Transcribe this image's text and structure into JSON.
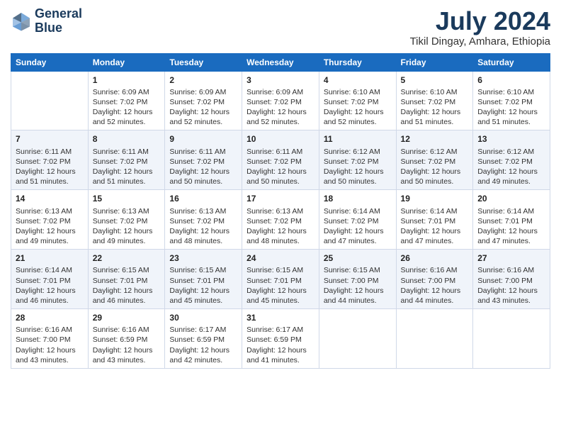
{
  "header": {
    "logo_line1": "General",
    "logo_line2": "Blue",
    "title": "July 2024",
    "subtitle": "Tikil Dingay, Amhara, Ethiopia"
  },
  "calendar": {
    "days_of_week": [
      "Sunday",
      "Monday",
      "Tuesday",
      "Wednesday",
      "Thursday",
      "Friday",
      "Saturday"
    ],
    "weeks": [
      [
        {
          "day": "",
          "info": ""
        },
        {
          "day": "1",
          "info": "Sunrise: 6:09 AM\nSunset: 7:02 PM\nDaylight: 12 hours\nand 52 minutes."
        },
        {
          "day": "2",
          "info": "Sunrise: 6:09 AM\nSunset: 7:02 PM\nDaylight: 12 hours\nand 52 minutes."
        },
        {
          "day": "3",
          "info": "Sunrise: 6:09 AM\nSunset: 7:02 PM\nDaylight: 12 hours\nand 52 minutes."
        },
        {
          "day": "4",
          "info": "Sunrise: 6:10 AM\nSunset: 7:02 PM\nDaylight: 12 hours\nand 52 minutes."
        },
        {
          "day": "5",
          "info": "Sunrise: 6:10 AM\nSunset: 7:02 PM\nDaylight: 12 hours\nand 51 minutes."
        },
        {
          "day": "6",
          "info": "Sunrise: 6:10 AM\nSunset: 7:02 PM\nDaylight: 12 hours\nand 51 minutes."
        }
      ],
      [
        {
          "day": "7",
          "info": "Sunrise: 6:11 AM\nSunset: 7:02 PM\nDaylight: 12 hours\nand 51 minutes."
        },
        {
          "day": "8",
          "info": "Sunrise: 6:11 AM\nSunset: 7:02 PM\nDaylight: 12 hours\nand 51 minutes."
        },
        {
          "day": "9",
          "info": "Sunrise: 6:11 AM\nSunset: 7:02 PM\nDaylight: 12 hours\nand 50 minutes."
        },
        {
          "day": "10",
          "info": "Sunrise: 6:11 AM\nSunset: 7:02 PM\nDaylight: 12 hours\nand 50 minutes."
        },
        {
          "day": "11",
          "info": "Sunrise: 6:12 AM\nSunset: 7:02 PM\nDaylight: 12 hours\nand 50 minutes."
        },
        {
          "day": "12",
          "info": "Sunrise: 6:12 AM\nSunset: 7:02 PM\nDaylight: 12 hours\nand 50 minutes."
        },
        {
          "day": "13",
          "info": "Sunrise: 6:12 AM\nSunset: 7:02 PM\nDaylight: 12 hours\nand 49 minutes."
        }
      ],
      [
        {
          "day": "14",
          "info": "Sunrise: 6:13 AM\nSunset: 7:02 PM\nDaylight: 12 hours\nand 49 minutes."
        },
        {
          "day": "15",
          "info": "Sunrise: 6:13 AM\nSunset: 7:02 PM\nDaylight: 12 hours\nand 49 minutes."
        },
        {
          "day": "16",
          "info": "Sunrise: 6:13 AM\nSunset: 7:02 PM\nDaylight: 12 hours\nand 48 minutes."
        },
        {
          "day": "17",
          "info": "Sunrise: 6:13 AM\nSunset: 7:02 PM\nDaylight: 12 hours\nand 48 minutes."
        },
        {
          "day": "18",
          "info": "Sunrise: 6:14 AM\nSunset: 7:02 PM\nDaylight: 12 hours\nand 47 minutes."
        },
        {
          "day": "19",
          "info": "Sunrise: 6:14 AM\nSunset: 7:01 PM\nDaylight: 12 hours\nand 47 minutes."
        },
        {
          "day": "20",
          "info": "Sunrise: 6:14 AM\nSunset: 7:01 PM\nDaylight: 12 hours\nand 47 minutes."
        }
      ],
      [
        {
          "day": "21",
          "info": "Sunrise: 6:14 AM\nSunset: 7:01 PM\nDaylight: 12 hours\nand 46 minutes."
        },
        {
          "day": "22",
          "info": "Sunrise: 6:15 AM\nSunset: 7:01 PM\nDaylight: 12 hours\nand 46 minutes."
        },
        {
          "day": "23",
          "info": "Sunrise: 6:15 AM\nSunset: 7:01 PM\nDaylight: 12 hours\nand 45 minutes."
        },
        {
          "day": "24",
          "info": "Sunrise: 6:15 AM\nSunset: 7:01 PM\nDaylight: 12 hours\nand 45 minutes."
        },
        {
          "day": "25",
          "info": "Sunrise: 6:15 AM\nSunset: 7:00 PM\nDaylight: 12 hours\nand 44 minutes."
        },
        {
          "day": "26",
          "info": "Sunrise: 6:16 AM\nSunset: 7:00 PM\nDaylight: 12 hours\nand 44 minutes."
        },
        {
          "day": "27",
          "info": "Sunrise: 6:16 AM\nSunset: 7:00 PM\nDaylight: 12 hours\nand 43 minutes."
        }
      ],
      [
        {
          "day": "28",
          "info": "Sunrise: 6:16 AM\nSunset: 7:00 PM\nDaylight: 12 hours\nand 43 minutes."
        },
        {
          "day": "29",
          "info": "Sunrise: 6:16 AM\nSunset: 6:59 PM\nDaylight: 12 hours\nand 43 minutes."
        },
        {
          "day": "30",
          "info": "Sunrise: 6:17 AM\nSunset: 6:59 PM\nDaylight: 12 hours\nand 42 minutes."
        },
        {
          "day": "31",
          "info": "Sunrise: 6:17 AM\nSunset: 6:59 PM\nDaylight: 12 hours\nand 41 minutes."
        },
        {
          "day": "",
          "info": ""
        },
        {
          "day": "",
          "info": ""
        },
        {
          "day": "",
          "info": ""
        }
      ]
    ]
  }
}
